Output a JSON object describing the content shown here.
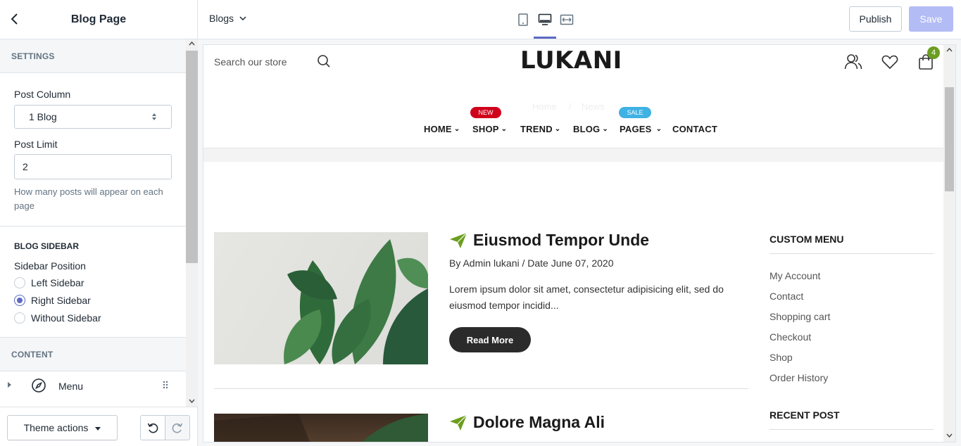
{
  "editor": {
    "title": "Blog Page",
    "settings_heading": "SETTINGS",
    "post_column": {
      "label": "Post Column",
      "value": "1 Blog"
    },
    "post_limit": {
      "label": "Post Limit",
      "value": "2",
      "help": "How many posts will appear on each page"
    },
    "blog_sidebar": {
      "heading": "BLOG SIDEBAR",
      "label": "Sidebar Position",
      "options": [
        "Left Sidebar",
        "Right Sidebar",
        "Without Sidebar"
      ],
      "selected": "Right Sidebar"
    },
    "content_heading": "CONTENT",
    "content_item": "Menu",
    "theme_actions": "Theme actions"
  },
  "topbar": {
    "page_selector": "Blogs",
    "devices": [
      "mobile-icon",
      "desktop-icon",
      "fullwidth-icon"
    ],
    "active_device": "desktop-icon",
    "publish": "Publish",
    "save": "Save",
    "accent_color": "#5c6ac4"
  },
  "store": {
    "search_placeholder": "Search our store",
    "logo": "LUKANI",
    "cart_count": "4",
    "breadcrumb": {
      "home": "Home",
      "separator": "/",
      "current": "News"
    },
    "nav": [
      {
        "label": "HOME"
      },
      {
        "label": "SHOP",
        "badge": "NEW",
        "badge_color": "#d0021b"
      },
      {
        "label": "TREND"
      },
      {
        "label": "BLOG"
      },
      {
        "label": "PAGES",
        "badge": "SALE",
        "badge_color": "#3fb1e3"
      },
      {
        "label": "CONTACT"
      }
    ]
  },
  "posts": [
    {
      "title": "Eiusmod Tempor Unde",
      "meta": "By Admin lukani / Date June 07, 2020",
      "excerpt": "Lorem ipsum dolor sit amet, consectetur adipisicing elit, sed do eiusmod tempor incidid...",
      "button": "Read More"
    },
    {
      "title": "Dolore Magna Ali"
    }
  ],
  "sidebar_widgets": {
    "custom_menu": {
      "title": "CUSTOM MENU",
      "links": [
        "My Account",
        "Contact",
        "Shopping cart",
        "Checkout",
        "Shop",
        "Order History"
      ]
    },
    "recent_post": {
      "title": "RECENT POST"
    }
  }
}
